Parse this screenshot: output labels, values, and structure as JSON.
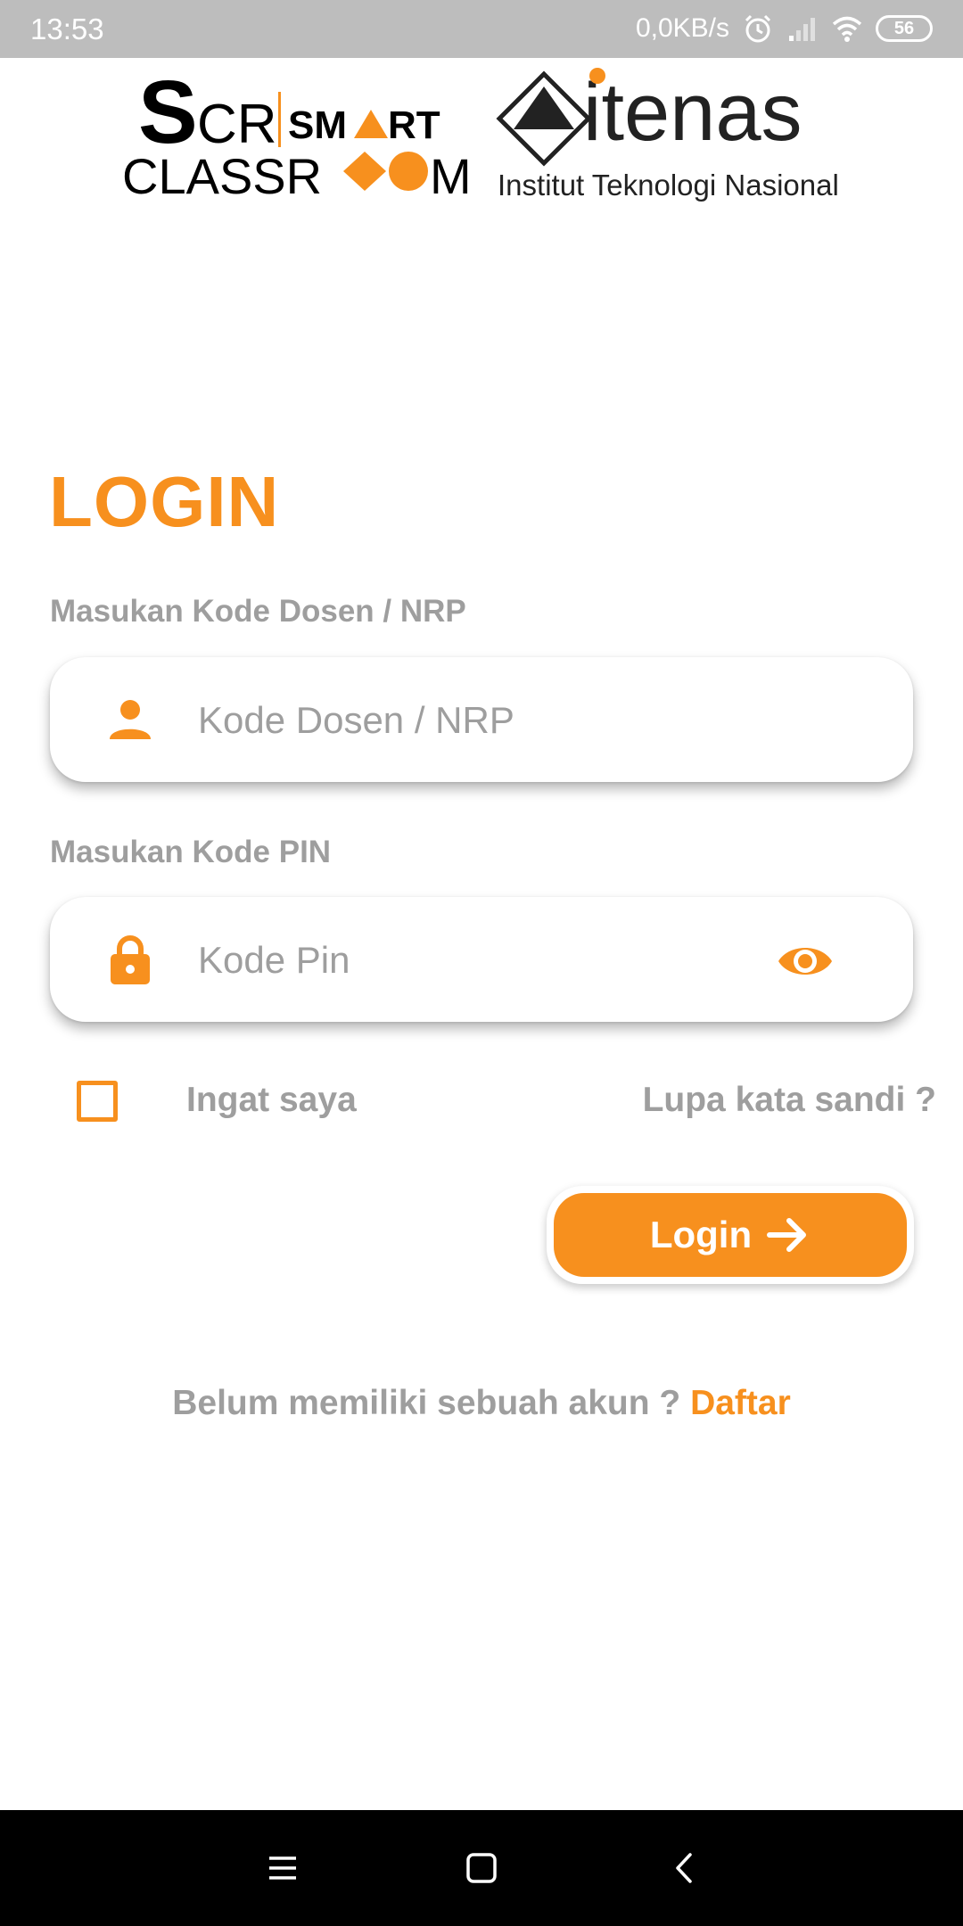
{
  "status_bar": {
    "time": "13:53",
    "network_speed": "0,0KB/s",
    "battery_level": "56",
    "icons": [
      "alarm-icon",
      "signal-icon",
      "wifi-icon",
      "battery-icon"
    ]
  },
  "logos": {
    "scr_logo_text": "SCR SMART CLASSROOM",
    "itenas_logo_text": "itenas",
    "itenas_subtitle": "Institut Teknologi Nasional"
  },
  "login": {
    "title": "LOGIN",
    "nrp_label": "Masukan Kode Dosen / NRP",
    "nrp_placeholder": "Kode Dosen / NRP",
    "nrp_value": "",
    "pin_label": "Masukan Kode PIN",
    "pin_placeholder": "Kode Pin",
    "pin_value": "",
    "remember_label": "Ingat saya",
    "remember_checked": false,
    "forgot_label": "Lupa kata sandi ?",
    "button_label": "Login",
    "signup_prompt": "Belum memiliki sebuah akun ?",
    "signup_link": "Daftar"
  },
  "colors": {
    "accent": "#f7901e",
    "label_gray": "#9e9e9e",
    "status_bar": "#bdbdbd",
    "nav_bar": "#000000"
  },
  "nav_bar": {
    "icons": [
      "menu-icon",
      "home-icon",
      "back-icon"
    ]
  }
}
